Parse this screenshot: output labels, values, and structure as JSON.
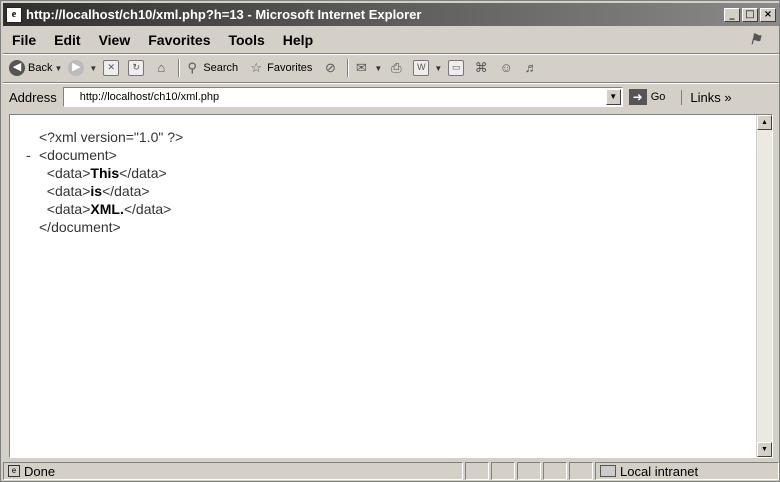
{
  "window": {
    "title": "http://localhost/ch10/xml.php?h=13 - Microsoft Internet Explorer",
    "controls": {
      "minimize": "_",
      "maximize": "□",
      "close": "×"
    }
  },
  "menubar": {
    "items": [
      {
        "label": "File"
      },
      {
        "label": "Edit"
      },
      {
        "label": "View"
      },
      {
        "label": "Favorites"
      },
      {
        "label": "Tools"
      },
      {
        "label": "Help"
      }
    ]
  },
  "toolbar": {
    "back_label": "Back",
    "search_label": "Search",
    "favorites_label": "Favorites",
    "icons": [
      "back-icon",
      "forward-icon",
      "stop-icon",
      "refresh-icon",
      "home-icon",
      "search-icon",
      "favorites-icon",
      "history-icon",
      "mail-icon",
      "print-icon",
      "edit-icon",
      "discuss-icon",
      "research-icon",
      "messenger-icon",
      "media-icon"
    ]
  },
  "addressbar": {
    "label": "Address",
    "url": "http://localhost/ch10/xml.php",
    "go_label": "Go",
    "links_label": "Links »"
  },
  "content": {
    "lines": [
      {
        "toggle": "",
        "indent": "",
        "pre": "<?xml version=\"1.0\" ?>",
        "bold": "",
        "post": ""
      },
      {
        "toggle": "-",
        "indent": "",
        "pre": "<document>",
        "bold": "",
        "post": ""
      },
      {
        "toggle": "",
        "indent": "  ",
        "pre": "<data>",
        "bold": "This",
        "post": "</data>"
      },
      {
        "toggle": "",
        "indent": "  ",
        "pre": "<data>",
        "bold": "is",
        "post": "</data>"
      },
      {
        "toggle": "",
        "indent": "  ",
        "pre": "<data>",
        "bold": "XML.",
        "post": "</data>"
      },
      {
        "toggle": "",
        "indent": "",
        "pre": "</document>",
        "bold": "",
        "post": ""
      }
    ]
  },
  "statusbar": {
    "status": "Done",
    "zone": "Local intranet"
  }
}
